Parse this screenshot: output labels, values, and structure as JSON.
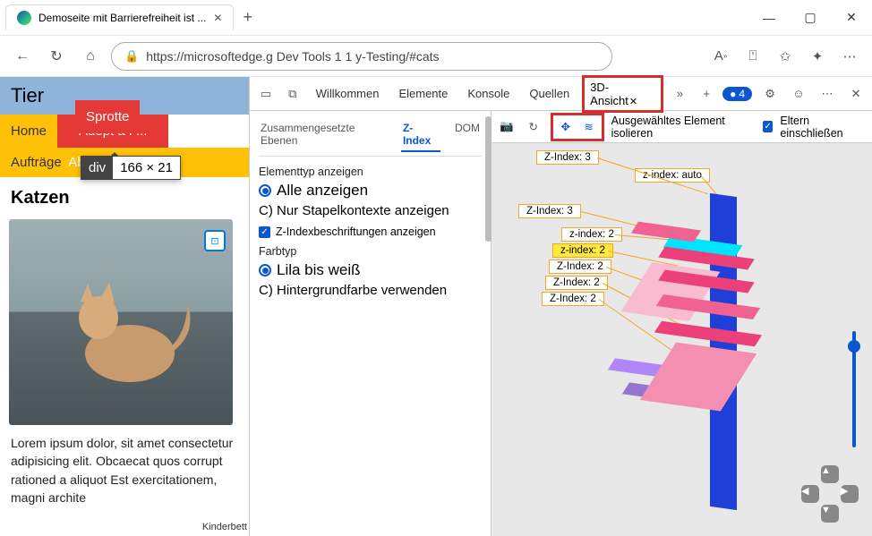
{
  "window": {
    "tab_title": "Demoseite mit Barrierefreiheit ist ...",
    "url": "https://microsoftedge.g Dev Tools 1 1 y-Testing/#cats"
  },
  "page": {
    "heading": "Tier",
    "nav_home": "Home",
    "nav_adopt": "Adopt a P...",
    "sprotte": "Sprotte",
    "nav_auftrage": "Aufträge",
    "nav_about": "About Uns",
    "tooltip_tag": "div",
    "tooltip_dims": "166 × 21",
    "h2": "Katzen",
    "lorem": "Lorem ipsum dolor, sit amet consectetur adipisicing elit. Obcaecat quos corrupt rationed a aliquot Est exercitationem, magni archite",
    "kinder": "Kinderbett"
  },
  "devtools": {
    "tabs": {
      "welcome": "Willkommen",
      "elements": "Elemente",
      "console": "Konsole",
      "sources": "Quellen",
      "view3d": "3D-Ansicht"
    },
    "issues_count": "4",
    "subtabs": {
      "composited": "Zusammengesetzte Ebenen",
      "zindex": "Z-Index",
      "dom": "DOM"
    },
    "settings": {
      "elemtype_title": "Elementtyp anzeigen",
      "opt_all": "Alle anzeigen",
      "opt_stack": "C) Nur Stapelkontexte anzeigen",
      "cb_labels": "Z-Indexbeschriftungen anzeigen",
      "colortype_title": "Farbtyp",
      "opt_lila": "Lila bis weiß",
      "opt_bg": "C) Hintergrundfarbe verwenden"
    },
    "toolbar3d": {
      "isolate": "Ausgewähltes Element isolieren",
      "parents": "Eltern einschließen"
    },
    "zlabels": {
      "z3a": "Z-Index: 3",
      "zauto": "z-index: auto",
      "z3b": "Z-Index: 3",
      "z2a": "z-index: 2",
      "z2sel": "z-index: 2",
      "z2b": "Z-Index: 2",
      "z2c": "Z-Index: 2",
      "z2d": "Z-Index: 2"
    }
  }
}
